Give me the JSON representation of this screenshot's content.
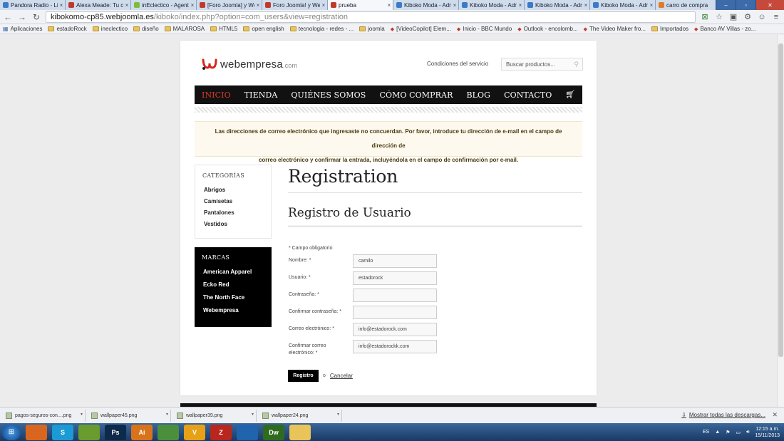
{
  "browser": {
    "tabs": [
      {
        "label": "Pandora Radio - Lis",
        "fav": "#3b7ac7",
        "active": false
      },
      {
        "label": "Alexa Meade: Tu cu",
        "fav": "#c0392b",
        "active": false
      },
      {
        "label": "inEclectico - Agente",
        "fav": "#7bbd3a",
        "active": false
      },
      {
        "label": "[Foro Joomla] y Web",
        "fav": "#c0392b",
        "active": false
      },
      {
        "label": "Foro Joomla! y Web",
        "fav": "#c0392b",
        "active": false
      },
      {
        "label": "prueba",
        "fav": "#c0392b",
        "active": true
      },
      {
        "label": "Kiboko Moda - Adm",
        "fav": "#3b7ac7",
        "active": false
      },
      {
        "label": "Kiboko Moda - Adm",
        "fav": "#3b7ac7",
        "active": false
      },
      {
        "label": "Kiboko Moda - Adm",
        "fav": "#3b7ac7",
        "active": false
      },
      {
        "label": "Kiboko Moda - Adm",
        "fav": "#3b7ac7",
        "active": false
      },
      {
        "label": "carro de compra",
        "fav": "#e07b2a",
        "active": false
      }
    ],
    "url_host": "kibokomo-cp85.webjoomla.es",
    "url_path": "/kiboko/index.php?option=com_users&view=registration",
    "bookmarks": [
      {
        "label": "Aplicaciones",
        "kind": "apps"
      },
      {
        "label": "estadoRock",
        "kind": "folder"
      },
      {
        "label": "ineclectico",
        "kind": "folder"
      },
      {
        "label": "diseño",
        "kind": "folder"
      },
      {
        "label": "MALAROSA",
        "kind": "folder"
      },
      {
        "label": "HTML5",
        "kind": "folder"
      },
      {
        "label": "open english",
        "kind": "folder"
      },
      {
        "label": "tecnologia - redes - ...",
        "kind": "folder"
      },
      {
        "label": "joomla",
        "kind": "folder"
      },
      {
        "label": "[VideoCopilot] Elem...",
        "kind": "link"
      },
      {
        "label": "Inicio - BBC Mundo",
        "kind": "link"
      },
      {
        "label": "Outlook - encolomb...",
        "kind": "link"
      },
      {
        "label": "The Video Maker fro...",
        "kind": "link"
      },
      {
        "label": "Importados",
        "kind": "folder"
      },
      {
        "label": "Banco AV Villas - zo...",
        "kind": "link"
      }
    ]
  },
  "site": {
    "logo_text": "webempresa",
    "logo_suffix": ".com",
    "terms_link": "Condiciones del servicio",
    "search_placeholder": "Buscar productos...",
    "menu": [
      {
        "label": "INICIO",
        "active": true
      },
      {
        "label": "TIENDA",
        "active": false
      },
      {
        "label": "QUIÉNES SOMOS",
        "active": false
      },
      {
        "label": "CÓMO COMPRAR",
        "active": false
      },
      {
        "label": "BLOG",
        "active": false
      },
      {
        "label": "CONTACTO",
        "active": false
      }
    ],
    "alert_line1": "Las direcciones de correo electrónico que ingresaste no concuerdan. Por favor, introduce tu dirección de e-mail en el campo de dirección de",
    "alert_line2": "correo electrónico y confirmar la entrada, incluyéndola en el campo de confirmación por e-mail.",
    "categories": {
      "title": "CATEGORÍAS",
      "items": [
        "Abrigos",
        "Camisetas",
        "Pantalones",
        "Vestidos"
      ]
    },
    "brands": {
      "title": "MARCAS",
      "items": [
        "American Apparel",
        "Ecko Red",
        "The North Face",
        "Webempresa"
      ]
    },
    "page_title": "Registration",
    "form_title": "Registro de Usuario",
    "required_note": "* Campo obligatorio",
    "fields": [
      {
        "label": "Nombre: *",
        "value": "camilo"
      },
      {
        "label": "Usuario: *",
        "value": "estadorock"
      },
      {
        "label": "Contraseña: *",
        "value": ""
      },
      {
        "label": "Confirmar contraseña: *",
        "value": ""
      },
      {
        "label": "Correo electrónico: *",
        "value": "info@estadorock.com"
      },
      {
        "label": "Confirmar correo electrónico: *",
        "value": "info@estadorockk.com"
      }
    ],
    "submit_label": "Registro",
    "or_text": "o",
    "cancel_label": "Cancelar"
  },
  "downloads": {
    "items": [
      "pagos-seguros-con....png",
      "wallpaper45.png",
      "wallpaper39.png",
      "wallpaper24.png"
    ],
    "show_all": "Mostrar todas las descargas..."
  },
  "taskbar": {
    "apps": [
      {
        "name": "firefox",
        "glyph": "",
        "color": "#d9661f"
      },
      {
        "name": "skype",
        "glyph": "S",
        "color": "#1b9ad6"
      },
      {
        "name": "app-green",
        "glyph": "",
        "color": "#6a9b2e"
      },
      {
        "name": "photoshop",
        "glyph": "Ps",
        "color": "#0d2a4a"
      },
      {
        "name": "illustrator",
        "glyph": "Ai",
        "color": "#d8731c"
      },
      {
        "name": "chrome",
        "glyph": "",
        "color": "#4b8f3c"
      },
      {
        "name": "vlc",
        "glyph": "V",
        "color": "#e6a117"
      },
      {
        "name": "filezilla",
        "glyph": "Z",
        "color": "#b8261e"
      },
      {
        "name": "app-blue",
        "glyph": "",
        "color": "#1f64ad"
      },
      {
        "name": "dreamweaver",
        "glyph": "Dw",
        "color": "#2f6b1f"
      },
      {
        "name": "explorer",
        "glyph": "",
        "color": "#e8c45a"
      }
    ],
    "lang": "ES",
    "time": "12:15 a.m.",
    "date": "15/11/2013"
  },
  "colors": {
    "accent_red": "#e03a2a",
    "menu_bg": "#111111",
    "alert_bg": "#fdf9ee"
  }
}
